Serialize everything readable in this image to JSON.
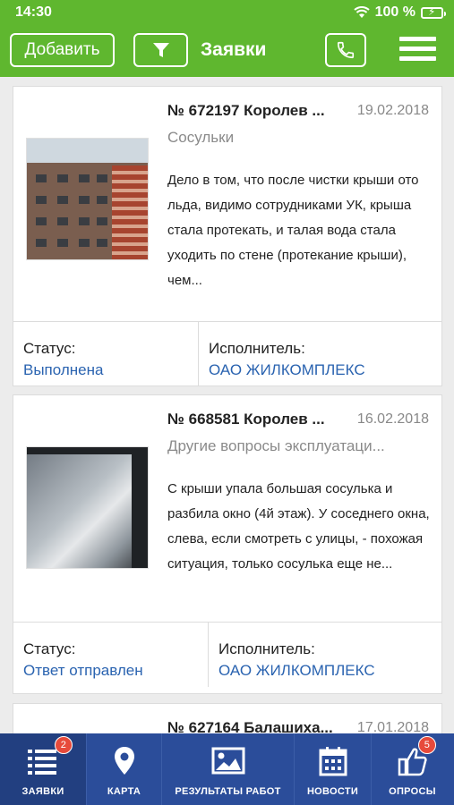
{
  "status_bar": {
    "time": "14:30",
    "battery": "100 %"
  },
  "header": {
    "add_label": "Добавить",
    "title": "Заявки",
    "filter_icon": "filter-icon",
    "phone_icon": "phone-icon",
    "menu_icon": "hamburger-menu-icon"
  },
  "cards": [
    {
      "number": "№ 672197 Королев ...",
      "date": "19.02.2018",
      "category": "Сосульки",
      "description": "Дело в том, что после чистки крыши ото льда, видимо сотрудниками УК, крыша стала протекать, и талая вода стала уходить по стене (протекание крыши), чем...",
      "status_label": "Статус:",
      "status_value": "Выполнена",
      "executor_label": "Исполнитель:",
      "executor_value": "ОАО ЖИЛКОМПЛЕКС"
    },
    {
      "number": "№ 668581 Королев ...",
      "date": "16.02.2018",
      "category": "Другие вопросы эксплуатаци...",
      "description": "С крыши упала большая сосулька и разбила окно (4й этаж). У соседнего окна, слева, если смотреть с улицы, - похожая ситуация, только сосулька еще не...",
      "status_label": "Статус:",
      "status_value": "Ответ отправлен",
      "executor_label": "Исполнитель:",
      "executor_value": "ОАО ЖИЛКОМПЛЕКС"
    },
    {
      "number": "№ 627164 Балашиха...",
      "date": "17.01.2018"
    }
  ],
  "tabs": [
    {
      "label": "ЗАЯВКИ",
      "icon": "list-icon",
      "badge": "2"
    },
    {
      "label": "КАРТА",
      "icon": "map-pin-icon"
    },
    {
      "label": "РЕЗУЛЬТАТЫ РАБОТ",
      "icon": "image-icon"
    },
    {
      "label": "НОВОСТИ",
      "icon": "calendar-icon"
    },
    {
      "label": "ОПРОСЫ",
      "icon": "thumbs-up-icon",
      "badge": "5"
    }
  ],
  "colors": {
    "header_green": "#5fb72f",
    "tabbar_blue": "#2b4d9a",
    "link_blue": "#2a63b0",
    "badge_red": "#e74a3b"
  }
}
